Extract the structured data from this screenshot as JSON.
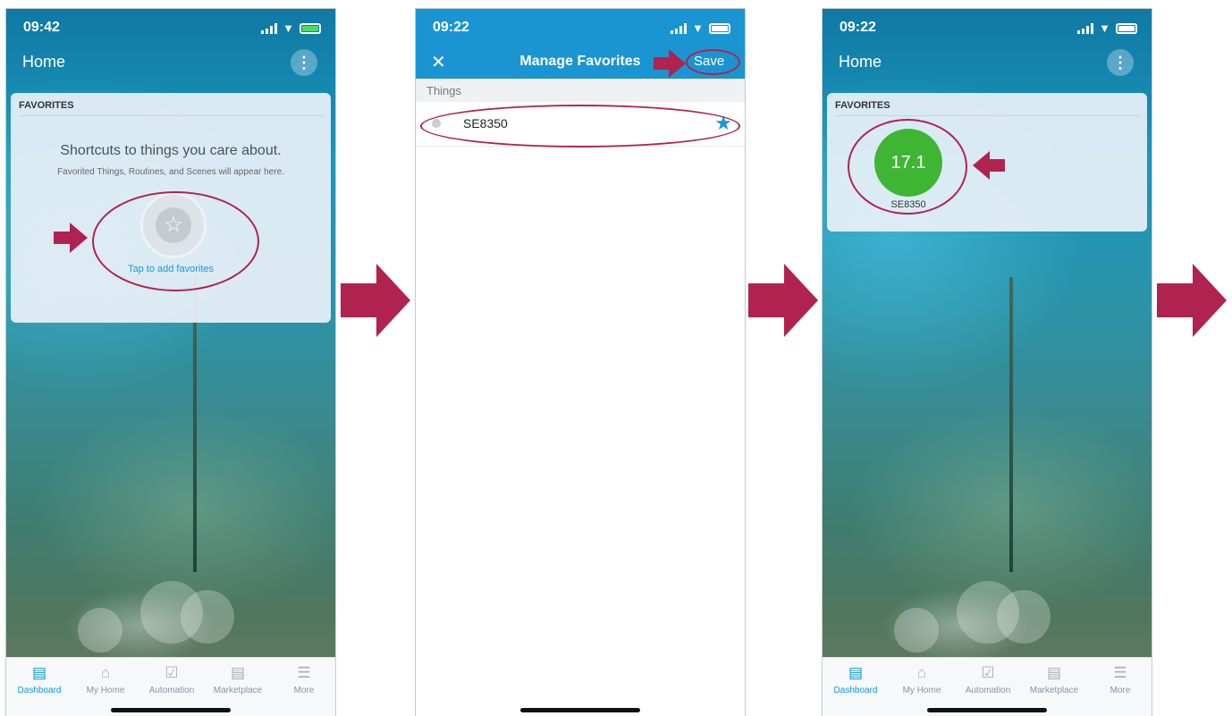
{
  "screen1": {
    "status_time": "09:42",
    "title": "Home",
    "menu_icon": "more-vertical-icon",
    "favorites_header": "FAVORITES",
    "empty_heading": "Shortcuts to things you care about.",
    "empty_subtext": "Favorited Things, Routines, and Scenes will appear here.",
    "add_label": "Tap to add favorites",
    "add_icon": "star-outline-icon"
  },
  "screen2": {
    "status_time": "09:22",
    "title": "Manage Favorites",
    "close_icon": "close-icon",
    "save_label": "Save",
    "section_header": "Things",
    "items": [
      {
        "name": "SE8350",
        "favorited": true
      }
    ]
  },
  "screen3": {
    "status_time": "09:22",
    "title": "Home",
    "favorites_header": "FAVORITES",
    "favorite_value": "17.1",
    "favorite_name": "SE8350",
    "favorite_color": "#3fb534"
  },
  "tabbar": {
    "tabs": [
      {
        "label": "Dashboard",
        "icon": "dashboard-icon",
        "active": true
      },
      {
        "label": "My Home",
        "icon": "home-icon",
        "active": false
      },
      {
        "label": "Automation",
        "icon": "automation-icon",
        "active": false
      },
      {
        "label": "Marketplace",
        "icon": "marketplace-icon",
        "active": false
      },
      {
        "label": "More",
        "icon": "menu-icon",
        "active": false
      }
    ]
  },
  "colors": {
    "accent": "#1198d6",
    "annotation": "#b0234f",
    "header_blue": "#1a95d2"
  }
}
